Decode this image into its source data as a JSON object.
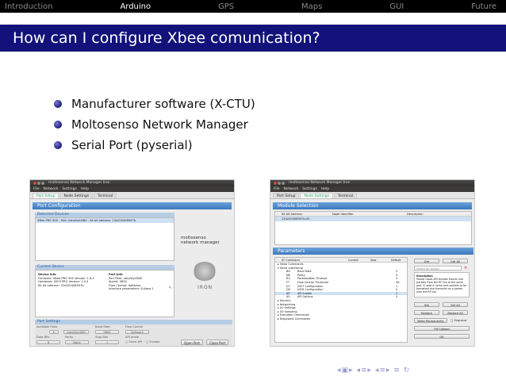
{
  "topnav": [
    "Introduction",
    "Arduino",
    "GPS",
    "Maps",
    "GUI",
    "Future"
  ],
  "active_tab": "Arduino",
  "title": "How can I configure Xbee comunication?",
  "bullets": [
    "Manufacturer software (X-CTU)",
    "Moltosenso Network Manager",
    "Serial Port (pyserial)"
  ],
  "left_shot": {
    "window_title": "moltosenso Network Manager Iron",
    "menu": [
      "File",
      "Network",
      "Settings",
      "Help"
    ],
    "tabs": [
      "Port Setup",
      "Node Settings",
      "Terminal"
    ],
    "banner": "Port Configuration",
    "detected_label": "Detected Devices",
    "detected_row": "XBee PRO 900 - Port: /dev/ttyUSB0 - 64 bit address: 13a200408947b",
    "brand1": "moltosenso",
    "brand2": "network manager",
    "iron": "IRON",
    "current_label": "Current Device",
    "device_info_head": "Device Info",
    "device_info": [
      "Firmware: XBee-PRO 900 Version: 1.8.5",
      "Hardware: 0003 PRO Version: 1.4.3",
      "64 bit address: 13a200408947b"
    ],
    "port_info_head": "Port Info",
    "port_info": [
      "Port Path: /dev/ttyUSB0",
      "Speed: 9600",
      "Flow Control: Software",
      "Interface parameters: 8-None-1"
    ],
    "port_settings_label": "Port Settings",
    "fields": [
      "Available Ports",
      "Baud Rate",
      "Flow Control",
      "Data Bits",
      "Parity",
      "Stop Bits",
      "API mode"
    ],
    "values": [
      "/dev/ttyUSB0",
      "9600",
      "Software",
      "8",
      "None",
      "1"
    ],
    "force_api": "Force API",
    "escape": "Escape",
    "open_port": "Open Port",
    "close_port": "Close Port"
  },
  "right_shot": {
    "window_title": "moltosenso Network Manager Iron",
    "menu": [
      "File",
      "Network",
      "Settings",
      "Help"
    ],
    "tabs": [
      "Port Setup",
      "Node Settings",
      "Terminal"
    ],
    "module_banner": "Module Selection",
    "module_cols": [
      "64 bit Address",
      "Node Identifier",
      "Description"
    ],
    "module_row": "13a200408947b-00",
    "params_banner": "Parameters",
    "param_cols": [
      "AT Command",
      "Current",
      "New",
      "Default"
    ],
    "param_groups": [
      "Sleep Commands",
      "Serial Interfacing"
    ],
    "param_rows": [
      [
        "BD",
        "Baud Rate",
        "3"
      ],
      [
        "NB",
        "Parity",
        "0"
      ],
      [
        "RO",
        "Packetization Timeout",
        "3"
      ],
      [
        "FT",
        "Flow Control Threshold",
        "3A"
      ],
      [
        "D7",
        "DIO7 Configuration",
        "1"
      ],
      [
        "D6",
        "DIO6 Configuration",
        "0"
      ],
      [
        "AP",
        "API Enable",
        "1"
      ],
      [
        "AO",
        "API Options",
        "0"
      ]
    ],
    "more_groups": [
      "Security",
      "Networking",
      "I/O Settings",
      "I/O Sampling",
      "Execution Commands",
      "Diagnostic Commands"
    ],
    "get": "Get",
    "get_all": "Get All",
    "select_action": "Select an action",
    "desc_head": "Description",
    "desc": "Packet mode API formats frames into packets from the RF link to the serial port. If used in serial port packets to be formatted and transmits as a packet over the RF link.",
    "set": "Set",
    "set_all": "Set All",
    "restore": "Restore",
    "restore_all": "Restore All",
    "write_perm": "Write Permanently",
    "enqueue": "Enqueue",
    "fw_upload": "FW Upload",
    "ok": "OK"
  }
}
